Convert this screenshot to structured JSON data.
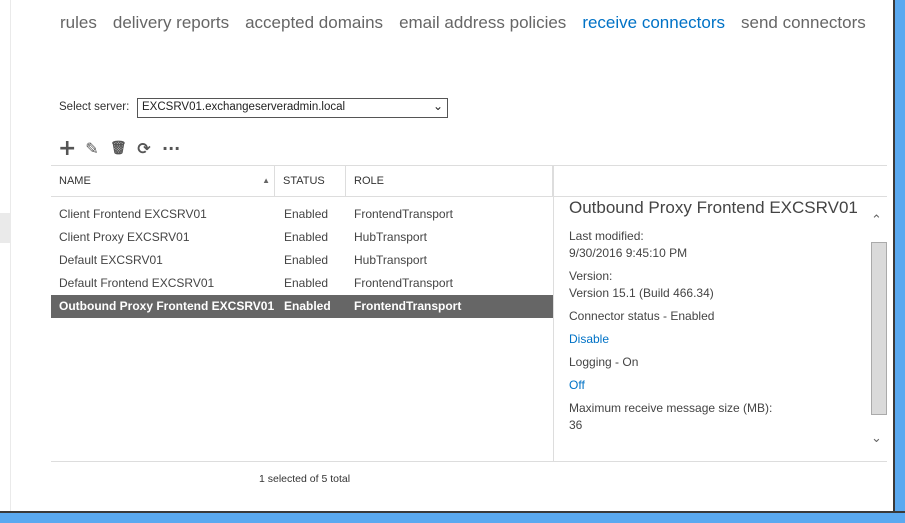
{
  "tabs": [
    {
      "label": "rules",
      "active": false
    },
    {
      "label": "delivery reports",
      "active": false
    },
    {
      "label": "accepted domains",
      "active": false
    },
    {
      "label": "email address policies",
      "active": false
    },
    {
      "label": "receive connectors",
      "active": true
    },
    {
      "label": "send connectors",
      "active": false
    }
  ],
  "server": {
    "label": "Select server:",
    "value": "EXCSRV01.exchangeserveradmin.local"
  },
  "toolbar": {
    "add": "+",
    "edit": "✎",
    "delete": "🗑",
    "refresh": "⟳",
    "more": "···"
  },
  "table": {
    "columns": [
      "NAME",
      "STATUS",
      "ROLE"
    ],
    "sort": "NAME ascending",
    "rows": [
      {
        "name": "Client Frontend EXCSRV01",
        "status": "Enabled",
        "role": "FrontendTransport"
      },
      {
        "name": "Client Proxy EXCSRV01",
        "status": "Enabled",
        "role": "HubTransport"
      },
      {
        "name": "Default EXCSRV01",
        "status": "Enabled",
        "role": "HubTransport"
      },
      {
        "name": "Default Frontend EXCSRV01",
        "status": "Enabled",
        "role": "FrontendTransport"
      },
      {
        "name": "Outbound Proxy Frontend EXCSRV01",
        "status": "Enabled",
        "role": "FrontendTransport",
        "selected": true
      }
    ]
  },
  "detail": {
    "title": "Outbound Proxy Frontend EXCSRV01",
    "last_modified_label": "Last modified:",
    "last_modified": "9/30/2016 9:45:10 PM",
    "version_label": "Version:",
    "version": "Version 15.1 (Build 466.34)",
    "connector_status": "Connector status - Enabled",
    "disable_link": "Disable",
    "logging": "Logging - On",
    "off_link": "Off",
    "max_size_label": "Maximum receive message size (MB):",
    "max_size": "36"
  },
  "footer": "1 selected of 5 total",
  "colors": {
    "accent": "#0072c6",
    "selected_row": "#666666",
    "window_border": "#5aa9f0"
  }
}
